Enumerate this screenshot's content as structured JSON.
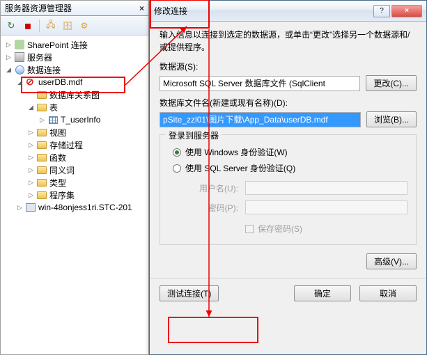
{
  "explorer": {
    "title": "服务器资源管理器",
    "close_x": "×",
    "tree": {
      "sharepoint": "SharePoint 连接",
      "servers": "服务器",
      "dataconn": "数据连接",
      "userdb": "userDB.mdf",
      "diagrams": "数据库关系图",
      "tables": "表",
      "t_userinfo": "T_userInfo",
      "views": "视图",
      "procs": "存储过程",
      "functions": "函数",
      "synonyms": "同义词",
      "types": "类型",
      "assemblies": "程序集",
      "win48": "win-48onjess1ri.STC-201"
    }
  },
  "dialog": {
    "title": "修改连接",
    "help": "?",
    "close": "×",
    "desc": "输入信息以连接到选定的数据源，或单击“更改”选择另一个数据源和/或提供程序。",
    "datasource_label": "数据源(S):",
    "datasource_value": "Microsoft SQL Server 数据库文件 (SqlClient",
    "change_btn": "更改(C)...",
    "dbfile_label": "数据库文件名(新建或现有名称)(D):",
    "dbfile_value": "pSite_zzl01\\图片下载\\App_Data\\userDB.mdf",
    "browse_btn": "浏览(B)...",
    "login_legend": "登录到服务器",
    "radio_win": "使用 Windows 身份验证(W)",
    "radio_sql": "使用 SQL Server 身份验证(Q)",
    "user_label": "用户名(U):",
    "pwd_label": "密码(P):",
    "save_pwd": "保存密码(S)",
    "advanced_btn": "高级(V)...",
    "test_btn": "测试连接(T)",
    "ok_btn": "确定",
    "cancel_btn": "取消"
  }
}
